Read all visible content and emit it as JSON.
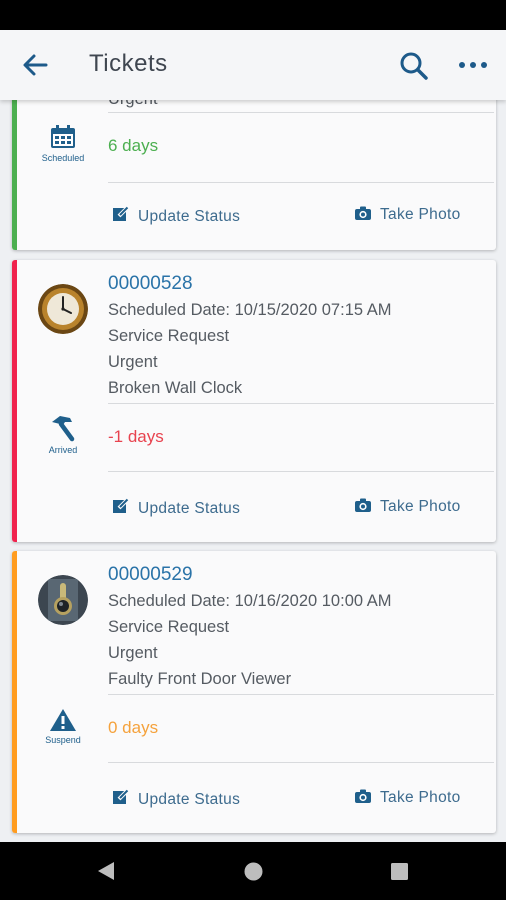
{
  "app_bar": {
    "title": "Tickets"
  },
  "tickets": [
    {
      "number": "",
      "lines": [
        "Urgent"
      ],
      "status_label": "Scheduled",
      "status_icon": "calendar-icon",
      "days": "6 days",
      "accent_color": "#4caf50",
      "days_color": "#4caf50",
      "actions": {
        "update": "Update Status",
        "photo": "Take Photo"
      }
    },
    {
      "number": "00000528",
      "lines": [
        "Scheduled Date: 10/15/2020 07:15 AM",
        "Service Request",
        "Urgent",
        "Broken Wall Clock"
      ],
      "status_label": "Arrived",
      "status_icon": "hammer-icon",
      "days": "-1 days",
      "accent_color": "#f0224d",
      "days_color": "#e8434f",
      "actions": {
        "update": "Update Status",
        "photo": "Take Photo"
      }
    },
    {
      "number": "00000529",
      "lines": [
        "Scheduled Date: 10/16/2020 10:00 AM",
        "Service Request",
        "Urgent",
        "Faulty Front Door Viewer"
      ],
      "status_label": "Suspend",
      "status_icon": "warning-icon",
      "days": "0 days",
      "accent_color": "#ff9c1f",
      "days_color": "#f5a23c",
      "actions": {
        "update": "Update Status",
        "photo": "Take Photo"
      }
    }
  ]
}
